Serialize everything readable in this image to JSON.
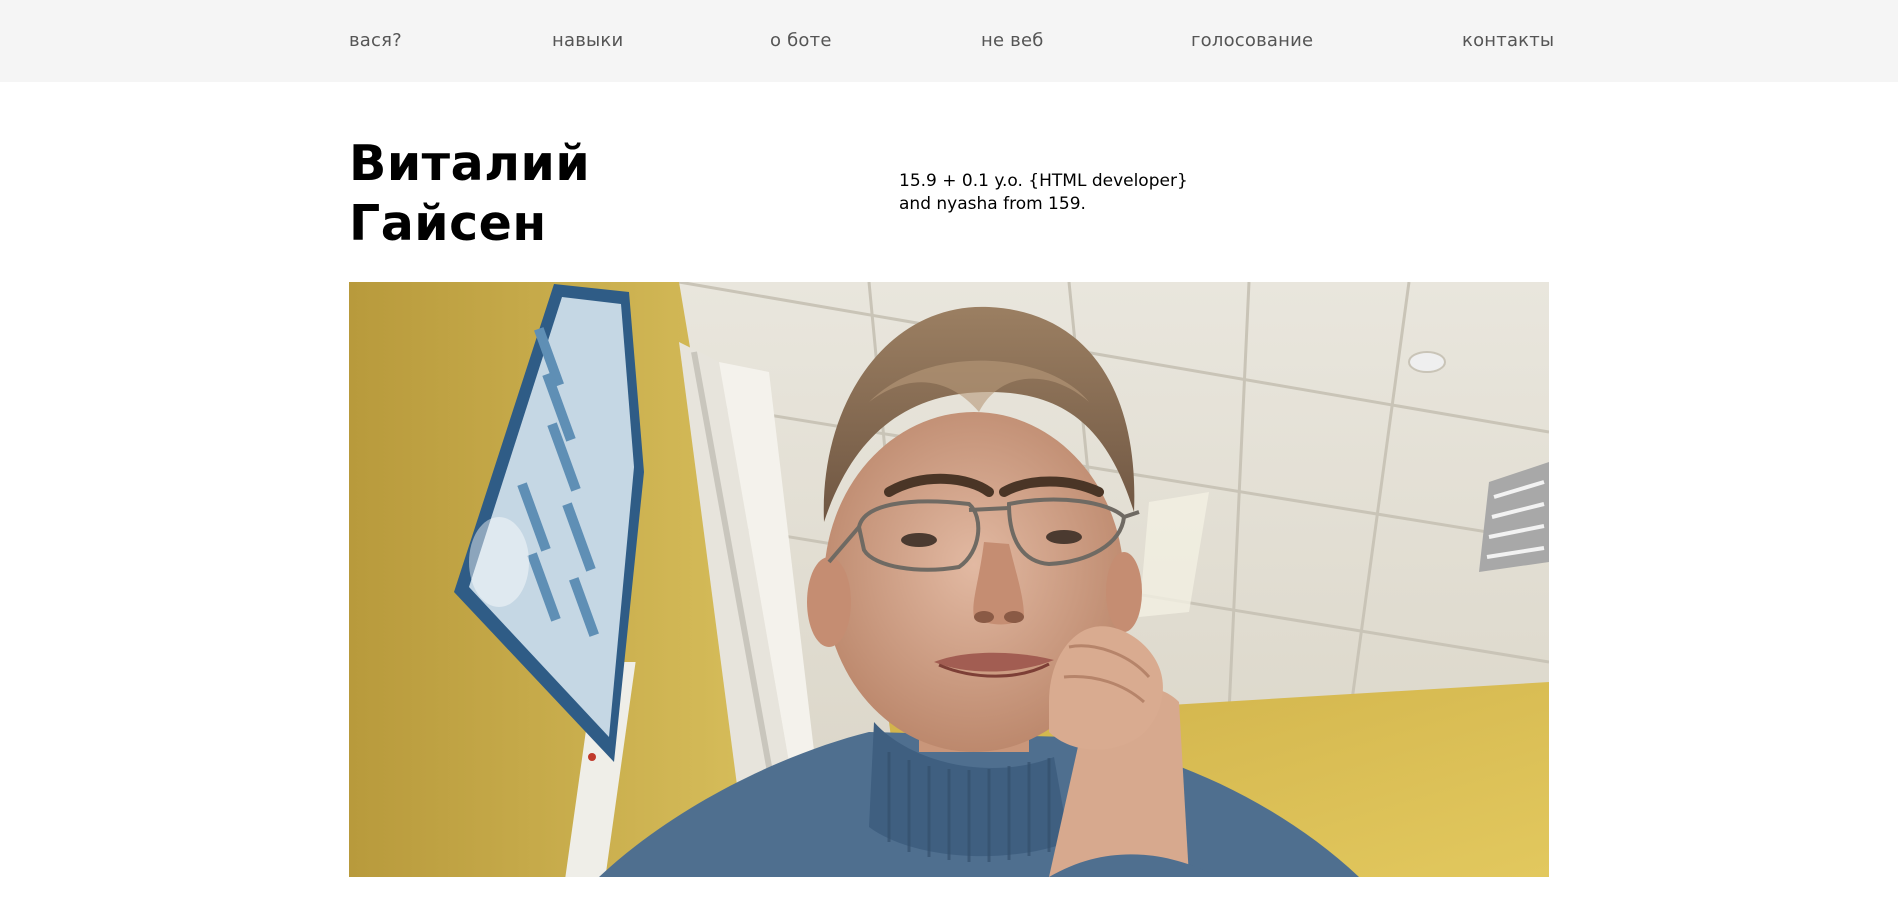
{
  "nav": {
    "items": [
      {
        "label": "вася?"
      },
      {
        "label": "навыки"
      },
      {
        "label": "о боте"
      },
      {
        "label": "не веб"
      },
      {
        "label": "голосование"
      },
      {
        "label": "контакты"
      }
    ]
  },
  "hero": {
    "name_line1": "Виталий",
    "name_line2": "Гайсен",
    "bio_line1": "15.9 + 0.1 y.o. {HTML developer}",
    "bio_line2": "and nyasha from 159."
  },
  "colors": {
    "nav_bg": "#f5f5f5",
    "nav_text": "#555555",
    "wall": "#d4b34a",
    "sweater": "#4f6f8f"
  }
}
